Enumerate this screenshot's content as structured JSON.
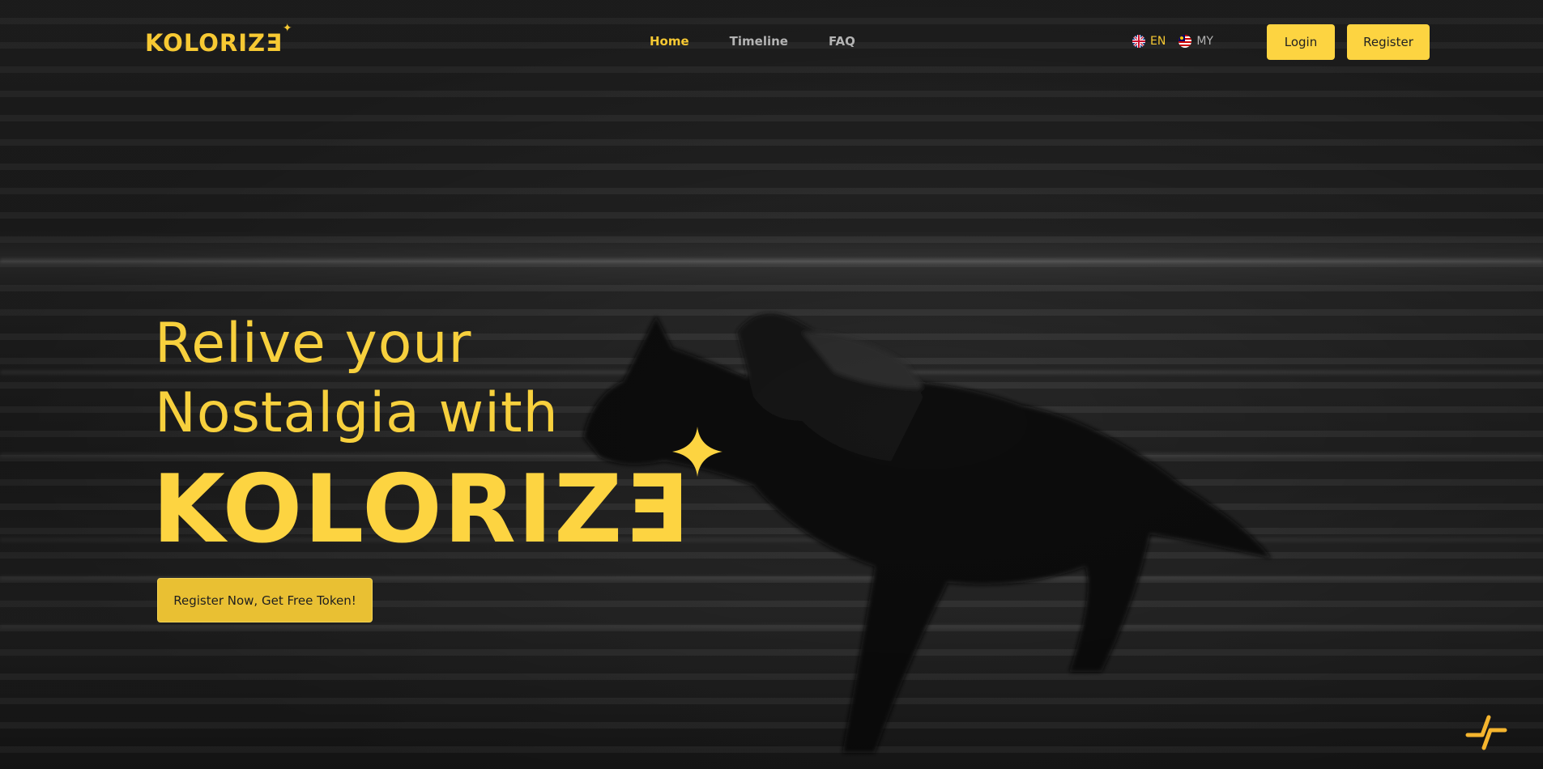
{
  "brand": {
    "name": "KOLORIZE",
    "logo_text": "KOLORIZƎ"
  },
  "nav": {
    "links": [
      {
        "label": "Home",
        "active": true
      },
      {
        "label": "Timeline",
        "active": false
      },
      {
        "label": "FAQ",
        "active": false
      }
    ]
  },
  "languages": [
    {
      "code": "EN",
      "flag_icon": "uk-flag-icon",
      "active": true
    },
    {
      "code": "MY",
      "flag_icon": "malaysia-flag-icon",
      "active": false
    }
  ],
  "auth": {
    "login_label": "Login",
    "register_label": "Register"
  },
  "hero": {
    "line1": "Relive your",
    "line2": "Nostalgia with",
    "brand_display": "KOLORIZƎ",
    "cta_label": "Register Now, Get Free Token!"
  },
  "colors": {
    "accent": "#fdd441",
    "text_muted": "#b3b3b3",
    "background": "#1a1a1a"
  }
}
